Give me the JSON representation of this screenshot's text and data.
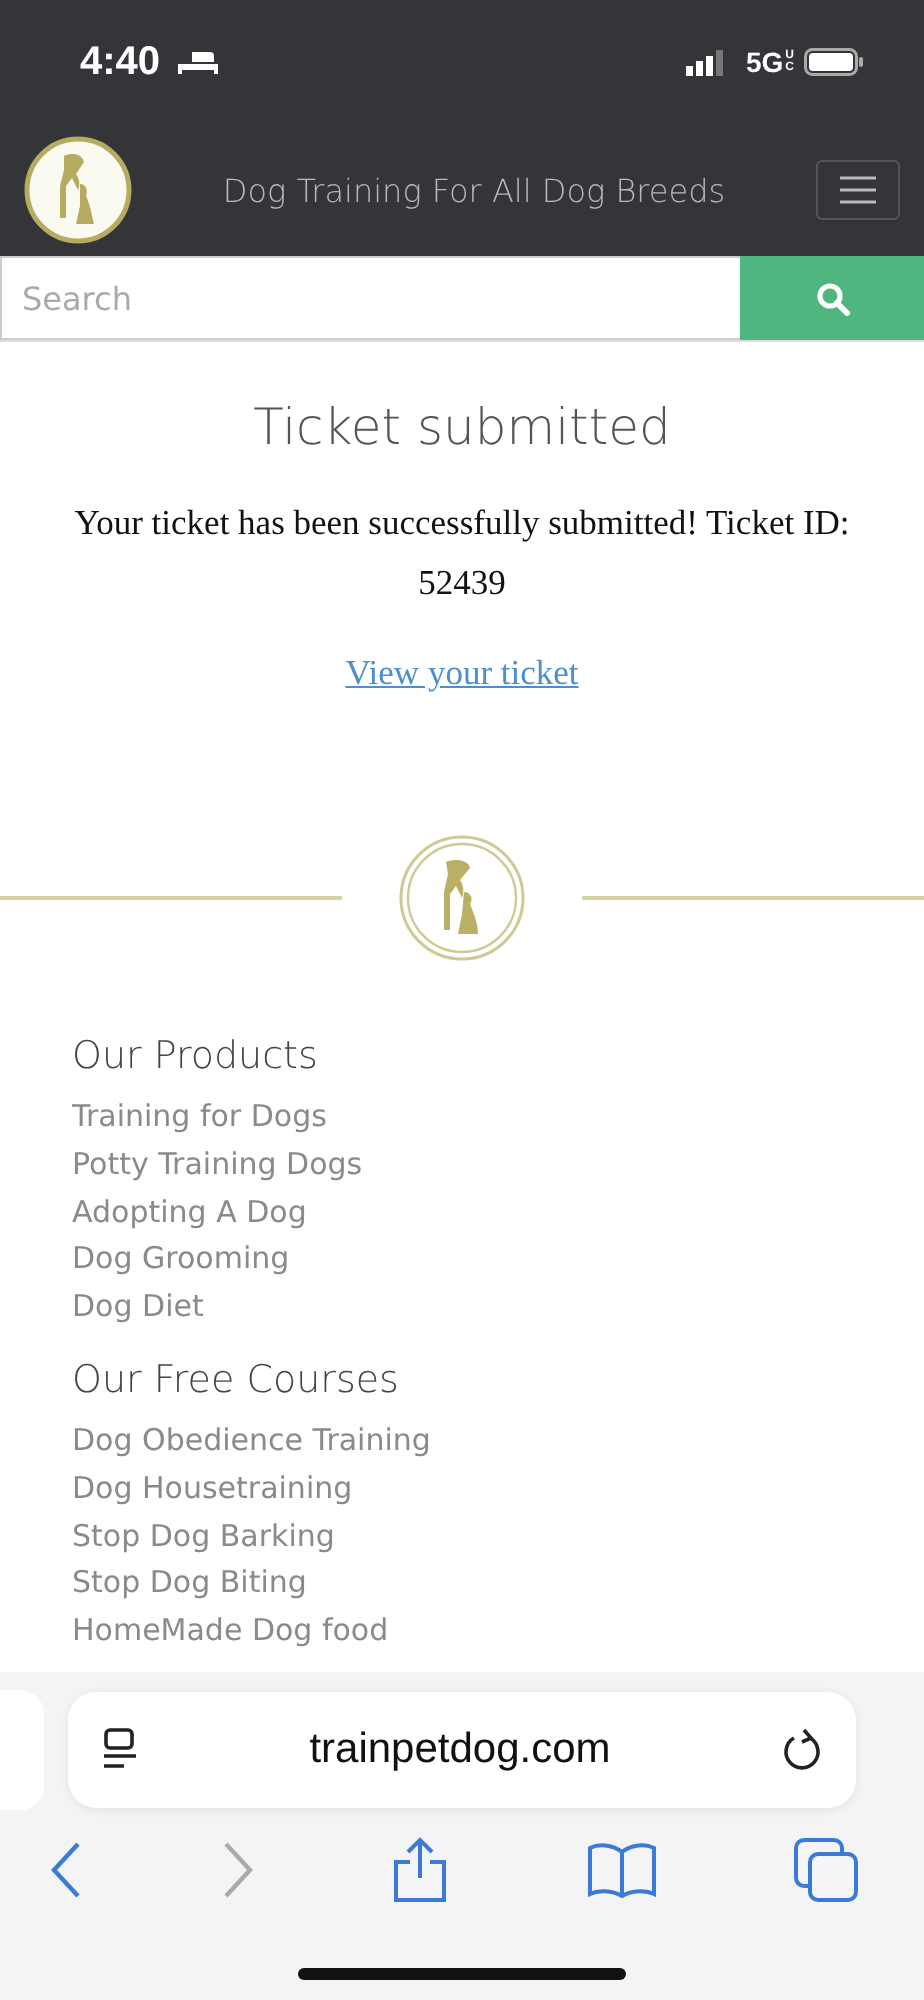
{
  "status_bar": {
    "time": "4:40",
    "network": "5G",
    "network_badge": "UC"
  },
  "header": {
    "title": "Dog Training For All Dog Breeds"
  },
  "search": {
    "placeholder": "Search"
  },
  "ticket": {
    "heading": "Ticket submitted",
    "message": "Your ticket has been successfully submitted! Ticket ID: 52439",
    "link": "View your ticket"
  },
  "footer_sections": [
    {
      "heading": "Our Products",
      "links": [
        "Training for Dogs",
        "Potty Training Dogs",
        "Adopting A Dog",
        "Dog Grooming",
        "Dog Diet"
      ]
    },
    {
      "heading": "Our Free Courses",
      "links": [
        "Dog Obedience Training",
        "Dog Housetraining",
        "Stop Dog Barking",
        "Stop Dog Biting",
        "HomeMade Dog food"
      ]
    }
  ],
  "browser": {
    "url": "trainpetdog.com",
    "back_disabled": false,
    "forward_disabled": true
  }
}
